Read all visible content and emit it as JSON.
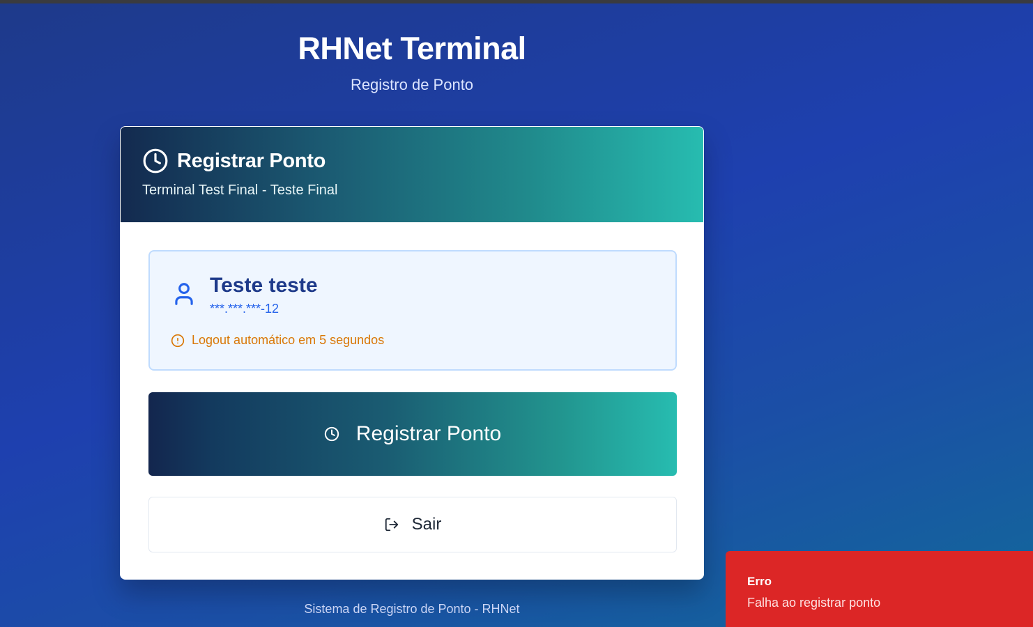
{
  "app": {
    "title": "RHNet Terminal",
    "subtitle": "Registro de Ponto"
  },
  "card": {
    "title": "Registrar Ponto",
    "terminal_label": "Terminal Test Final - Teste Final",
    "icon": "clock-icon"
  },
  "user": {
    "name": "Teste teste",
    "cpf_masked": "***.***.***-12",
    "icon": "user-icon",
    "logout_notice": "Logout automático em 5 segundos"
  },
  "actions": {
    "register_label": "Registrar Ponto",
    "exit_label": "Sair"
  },
  "footer": {
    "text": "Sistema de Registro de Ponto - RHNet"
  },
  "toast": {
    "title": "Erro",
    "message": "Falha ao registrar ponto"
  },
  "colors": {
    "background": "#1e40af",
    "accent_teal": "#27bcb0",
    "accent_navy": "#13264e",
    "warning": "#d97706",
    "error": "#dc2626",
    "user_panel_bg": "#eff6ff"
  }
}
